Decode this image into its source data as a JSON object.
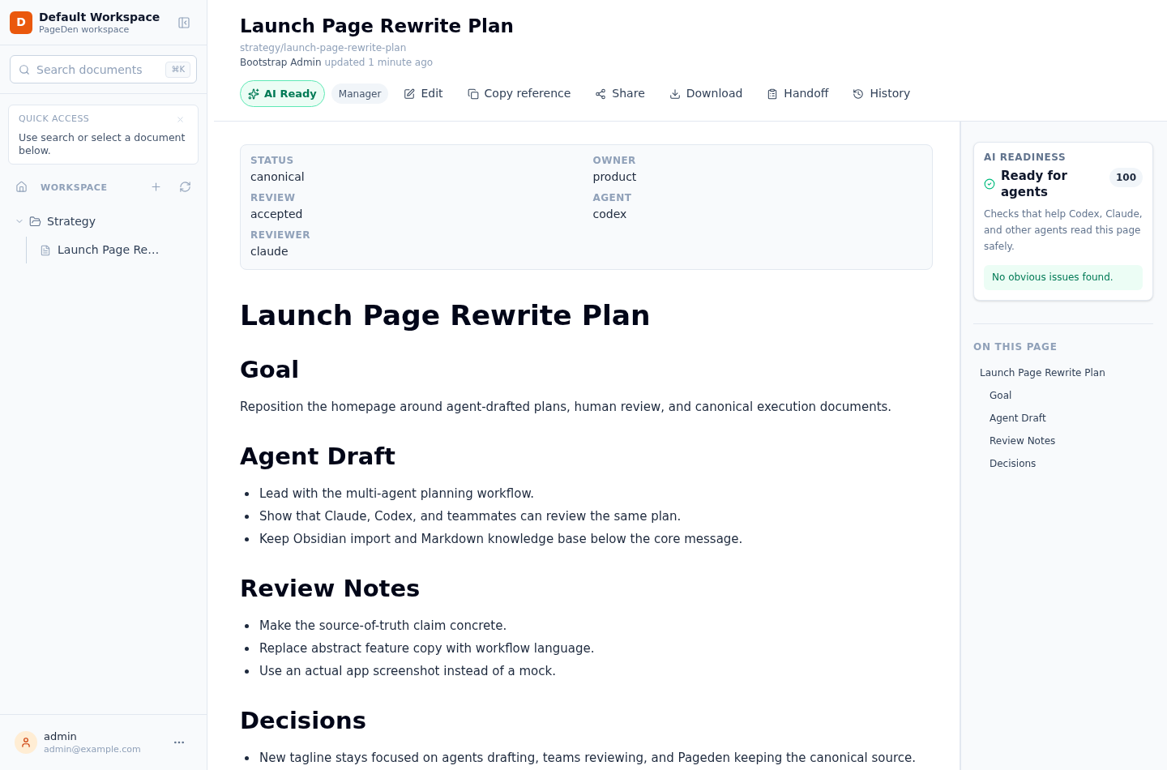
{
  "sidebar": {
    "workspace": {
      "logo_letter": "D",
      "name": "Default Workspace",
      "subtitle": "PageDen workspace"
    },
    "search": {
      "placeholder": "Search documents",
      "shortcut": "⌘K"
    },
    "quick_access": {
      "title": "QUICK ACCESS",
      "text": "Use search or select a document below."
    },
    "section_label": "WORKSPACE",
    "tree": [
      {
        "label": "Strategy",
        "kind": "folder",
        "expanded": true,
        "selected": false,
        "children": [
          {
            "label": "Launch Page Re…",
            "kind": "document",
            "selected": false
          }
        ]
      }
    ],
    "user": {
      "name": "admin",
      "email": "admin@example.com"
    }
  },
  "document": {
    "title": "Launch Page Rewrite Plan",
    "path": "strategy/launch-page-rewrite-plan",
    "author": "Bootstrap Admin",
    "updated": "updated 1 minute ago",
    "badges": [
      {
        "label": "AI Ready",
        "kind": "ai"
      },
      {
        "label": "Manager",
        "kind": "role"
      }
    ],
    "actions": [
      "Edit",
      "Copy reference",
      "Share",
      "Download",
      "Handoff",
      "History"
    ]
  },
  "metadata": [
    {
      "label": "STATUS",
      "value": "canonical"
    },
    {
      "label": "OWNER",
      "value": "product"
    },
    {
      "label": "REVIEW",
      "value": "accepted"
    },
    {
      "label": "AGENT",
      "value": "codex"
    },
    {
      "label": "REVIEWER",
      "value": "claude"
    }
  ],
  "content": [
    {
      "kind": "h1",
      "text": "Launch Page Rewrite Plan"
    },
    {
      "kind": "h2",
      "text": "Goal"
    },
    {
      "kind": "paragraph",
      "text": "Reposition the homepage around agent-drafted plans, human review, and canonical execution documents."
    },
    {
      "kind": "h2",
      "text": "Agent Draft"
    },
    {
      "kind": "list",
      "items": [
        "Lead with the multi-agent planning workflow.",
        "Show that Claude, Codex, and teammates can review the same plan.",
        "Keep Obsidian import and Markdown knowledge base below the core message."
      ]
    },
    {
      "kind": "h2",
      "text": "Review Notes"
    },
    {
      "kind": "list",
      "items": [
        "Make the source-of-truth claim concrete.",
        "Replace abstract feature copy with workflow language.",
        "Use an actual app screenshot instead of a mock."
      ]
    },
    {
      "kind": "h2",
      "text": "Decisions"
    },
    {
      "kind": "list",
      "items": [
        "New tagline stays focused on agents drafting, teams reviewing, and Pageden keeping the canonical source."
      ]
    }
  ],
  "ai_readiness": {
    "title": "AI READINESS",
    "status": "Ready for agents",
    "score": "100",
    "description": "Checks that help Codex, Claude, and other agents read this page safely.",
    "result": "No obvious issues found."
  },
  "toc": {
    "title": "ON THIS PAGE",
    "items": [
      {
        "label": "Launch Page Rewrite Plan",
        "children": [
          {
            "label": "Goal"
          },
          {
            "label": "Agent Draft"
          },
          {
            "label": "Review Notes"
          },
          {
            "label": "Decisions"
          }
        ]
      }
    ]
  }
}
